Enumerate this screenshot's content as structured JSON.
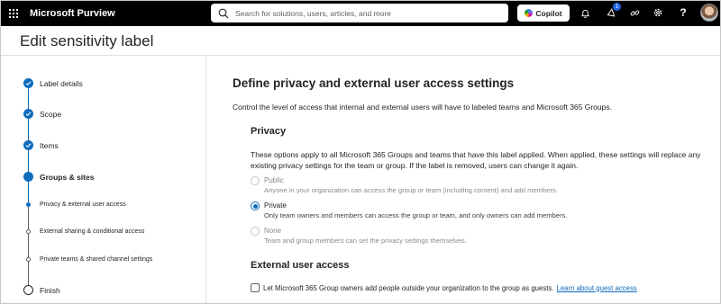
{
  "topbar": {
    "app_title": "Microsoft Purview",
    "search_placeholder": "Search for solutions, users, articles, and more",
    "copilot_label": "Copilot",
    "notification_count": "1",
    "help_label": "?"
  },
  "page": {
    "title": "Edit sensitivity label"
  },
  "wizard": {
    "steps": [
      {
        "label": "Label details",
        "state": "completed"
      },
      {
        "label": "Scope",
        "state": "completed"
      },
      {
        "label": "Items",
        "state": "completed"
      },
      {
        "label": "Groups & sites",
        "state": "current"
      },
      {
        "label": "Privacy & external user access",
        "state": "current-sub"
      },
      {
        "label": "External sharing & conditional access",
        "state": "pending-sub"
      },
      {
        "label": "Private teams & shared channel settings",
        "state": "pending-sub"
      },
      {
        "label": "Finish",
        "state": "pending"
      }
    ]
  },
  "main": {
    "title": "Define privacy and external user access settings",
    "description": "Control the level of access that internal and external users will have to labeled teams and Microsoft 365 Groups.",
    "privacy": {
      "heading": "Privacy",
      "description": "These options apply to all Microsoft 365 Groups and teams that have this label applied. When applied, these settings will replace any existing privacy settings for the team or group. If the label is removed, users can change it again.",
      "options": [
        {
          "label": "Public",
          "description": "Anyone in your organization can access the group or team (including content) and add members.",
          "selected": false
        },
        {
          "label": "Private",
          "description": "Only team owners and members can access the group or team, and only owners can add members.",
          "selected": true
        },
        {
          "label": "None",
          "description": "Team and group members can set the privacy settings themselves.",
          "selected": false
        }
      ]
    },
    "external": {
      "heading": "External user access",
      "checkbox_label": "Let Microsoft 365 Group owners add people outside your organization to the group as guests.",
      "checkbox_checked": false,
      "link_text": "Learn about guest access"
    }
  },
  "colors": {
    "accent": "#0f6cbd",
    "topbar": "#000000"
  }
}
